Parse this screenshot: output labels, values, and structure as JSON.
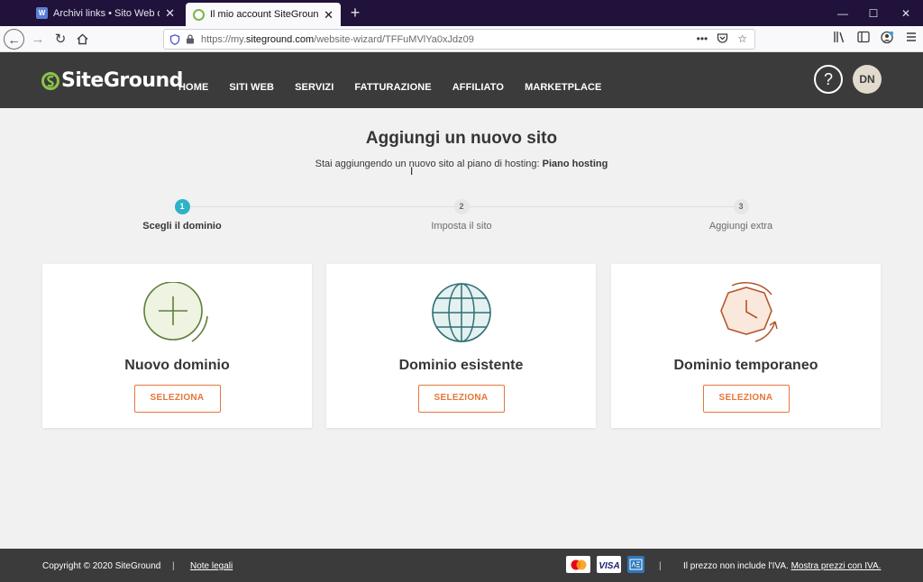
{
  "browser": {
    "tabs": [
      {
        "title": "Archivi links • Sito Web di Danilo",
        "favicon": "wp-icon",
        "active": false
      },
      {
        "title": "Il mio account SiteGround",
        "favicon": "siteground-icon",
        "active": true
      }
    ],
    "url": {
      "prefix": "https://my.",
      "host": "siteground.com",
      "path": "/website-wizard/TFFuMVlYa0xJdz09"
    },
    "url_actions": [
      "more-icon",
      "pocket-icon",
      "star-icon"
    ],
    "tools": [
      "library-icon",
      "sidebar-icon",
      "account-icon",
      "menu-icon"
    ]
  },
  "header": {
    "logo": "SiteGround",
    "menu": [
      "HOME",
      "SITI WEB",
      "SERVIZI",
      "FATTURAZIONE",
      "AFFILIATO",
      "MARKETPLACE"
    ],
    "help": "?",
    "avatar": "DN"
  },
  "main": {
    "title": "Aggiungi un nuovo sito",
    "subtitle_prefix": "Stai aggiungendo un nuovo sito al piano di hosting: ",
    "subtitle_plan": "Piano hosting",
    "steps": [
      {
        "number": "1",
        "label": "Scegli il dominio",
        "active": true
      },
      {
        "number": "2",
        "label": "Imposta il sito",
        "active": false
      },
      {
        "number": "3",
        "label": "Aggiungi extra",
        "active": false
      }
    ],
    "cards": [
      {
        "title": "Nuovo dominio",
        "button": "SELEZIONA",
        "icon": "plus-circle-icon"
      },
      {
        "title": "Dominio esistente",
        "button": "SELEZIONA",
        "icon": "globe-icon"
      },
      {
        "title": "Dominio temporaneo",
        "button": "SELEZIONA",
        "icon": "clock-icon"
      }
    ]
  },
  "footer": {
    "copyright": "Copyright © 2020 SiteGround",
    "separator": "|",
    "legal": "Note legali",
    "payment_icons": [
      "mastercard-icon",
      "visa-icon",
      "amex-icon"
    ],
    "vat_note": "Il prezzo non include l'IVA. ",
    "vat_link": "Mostra prezzi con IVA."
  },
  "colors": {
    "accent": "#e6763b",
    "step_active": "#2db3c6",
    "header_bg": "#3b3b3b",
    "logo_green": "#8bc34a"
  }
}
